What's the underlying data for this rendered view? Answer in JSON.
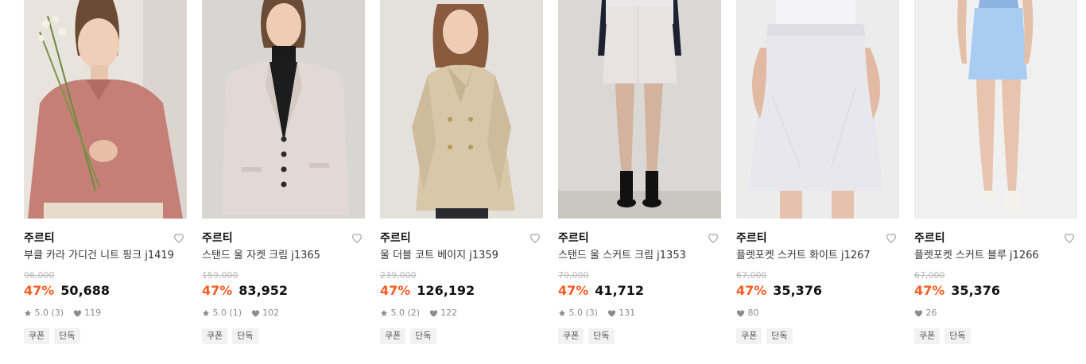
{
  "colors": {
    "discount": "#ff5a1f",
    "price": "#111111",
    "muted": "#8c8c8c"
  },
  "products": [
    {
      "brand": "주르티",
      "name": "부클 카라 가디건 니트 핑크 j1419",
      "original_price": "96,000",
      "discount_rate": "47%",
      "sale_price": "50,688",
      "rating": "5.0 (3)",
      "likes": "119",
      "tags": [
        "쿠폰",
        "단독"
      ],
      "image": "pink knit collared cardigan"
    },
    {
      "brand": "주르티",
      "name": "스탠드 울 자켓 크림 j1365",
      "original_price": "159,000",
      "discount_rate": "47%",
      "sale_price": "83,952",
      "rating": "5.0 (1)",
      "likes": "102",
      "tags": [
        "쿠폰",
        "단독"
      ],
      "image": "cream wool jacket"
    },
    {
      "brand": "주르티",
      "name": "울 더블 코트 베이지 j1359",
      "original_price": "239,000",
      "discount_rate": "47%",
      "sale_price": "126,192",
      "rating": "5.0 (2)",
      "likes": "122",
      "tags": [
        "쿠폰",
        "단독"
      ],
      "image": "beige double-breasted wool coat"
    },
    {
      "brand": "주르티",
      "name": "스탠드 울 스커트 크림 j1353",
      "original_price": "79,000",
      "discount_rate": "47%",
      "sale_price": "41,712",
      "rating": "5.0 (3)",
      "likes": "131",
      "tags": [
        "쿠폰",
        "단독"
      ],
      "image": "cream wool mini skirt"
    },
    {
      "brand": "주르티",
      "name": "플렛포켓 스커트 화이트 j1267",
      "original_price": "67,000",
      "discount_rate": "47%",
      "sale_price": "35,376",
      "rating": "",
      "likes": "80",
      "tags": [
        "쿠폰",
        "단독"
      ],
      "image": "white pocket skirt"
    },
    {
      "brand": "주르티",
      "name": "플렛포켓 스커트 블루 j1266",
      "original_price": "67,000",
      "discount_rate": "47%",
      "sale_price": "35,376",
      "rating": "",
      "likes": "26",
      "tags": [
        "쿠폰",
        "단독"
      ],
      "image": "light blue pocket skirt"
    }
  ]
}
